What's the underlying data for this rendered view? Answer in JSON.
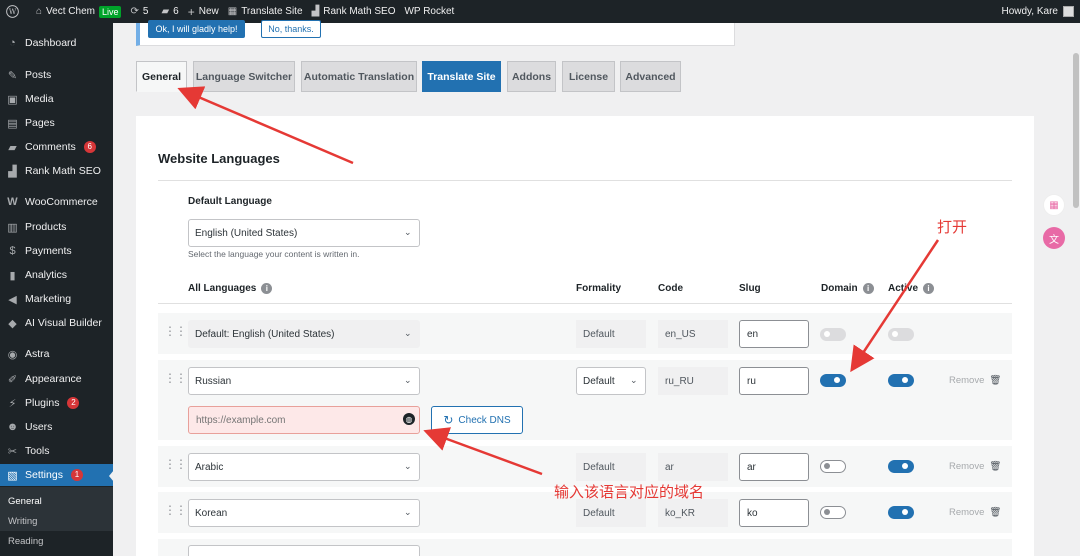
{
  "admin_bar": {
    "site_name": "Vect Chem",
    "live_badge": "Live",
    "updates_count": "5",
    "comments_count": "6",
    "new_label": "New",
    "translate_site": "Translate Site",
    "rank_math": "Rank Math SEO",
    "wp_rocket": "WP Rocket",
    "howdy": "Howdy, Kare"
  },
  "sidebar": {
    "items": [
      {
        "label": "Dashboard",
        "icon": "dashboard-icon"
      },
      {
        "label": "Posts",
        "icon": "pin-icon"
      },
      {
        "label": "Media",
        "icon": "media-icon"
      },
      {
        "label": "Pages",
        "icon": "page-icon"
      },
      {
        "label": "Comments",
        "icon": "comment-icon",
        "badge": "6"
      },
      {
        "label": "Rank Math SEO",
        "icon": "chart-icon"
      },
      {
        "label": "WooCommerce",
        "icon": "woo-icon"
      },
      {
        "label": "Products",
        "icon": "box-icon"
      },
      {
        "label": "Payments",
        "icon": "dollar-icon"
      },
      {
        "label": "Analytics",
        "icon": "bars-icon"
      },
      {
        "label": "Marketing",
        "icon": "megaphone-icon"
      },
      {
        "label": "AI Visual Builder",
        "icon": "ai-icon"
      },
      {
        "label": "Astra",
        "icon": "astra-icon"
      },
      {
        "label": "Appearance",
        "icon": "brush-icon"
      },
      {
        "label": "Plugins",
        "icon": "plug-icon",
        "badge": "2"
      },
      {
        "label": "Users",
        "icon": "user-icon"
      },
      {
        "label": "Tools",
        "icon": "wrench-icon"
      },
      {
        "label": "Settings",
        "icon": "settings-icon",
        "badge": "1"
      }
    ],
    "submenu": [
      "General",
      "Writing",
      "Reading"
    ]
  },
  "notice": {
    "primary_button": "Ok, I will gladly help!",
    "secondary_button": "No, thanks."
  },
  "tabs": [
    "General",
    "Language Switcher",
    "Automatic Translation",
    "Translate Site",
    "Addons",
    "License",
    "Advanced"
  ],
  "panel": {
    "heading": "Website Languages",
    "default_language_label": "Default Language",
    "default_language_value": "English (United States)",
    "default_language_desc": "Select the language your content is written in.",
    "columns": {
      "all_languages": "All Languages",
      "formality": "Formality",
      "code": "Code",
      "slug": "Slug",
      "domain": "Domain",
      "active": "Active"
    },
    "rows": [
      {
        "language": "Default: English (United States)",
        "formality": "Default",
        "code": "en_US",
        "slug": "en",
        "domain": "disabled",
        "active": "disabled",
        "remove": ""
      },
      {
        "language": "Russian",
        "formality": "Default",
        "code": "ru_RU",
        "slug": "ru",
        "domain": "on",
        "active": "on",
        "remove": "Remove"
      },
      {
        "language": "Arabic",
        "formality": "Default",
        "code": "ar",
        "slug": "ar",
        "domain": "off",
        "active": "on",
        "remove": "Remove"
      },
      {
        "language": "Korean",
        "formality": "Default",
        "code": "ko_KR",
        "slug": "ko",
        "domain": "off",
        "active": "on",
        "remove": "Remove"
      }
    ],
    "domain_input_placeholder": "https://example.com",
    "check_dns_button": "Check DNS"
  },
  "annotations": {
    "open_label": "打开",
    "domain_label": "输入该语言对应的域名"
  },
  "colors": {
    "accent": "#2271b1",
    "annotation": "#e53935",
    "admin_dark": "#1d2327"
  }
}
